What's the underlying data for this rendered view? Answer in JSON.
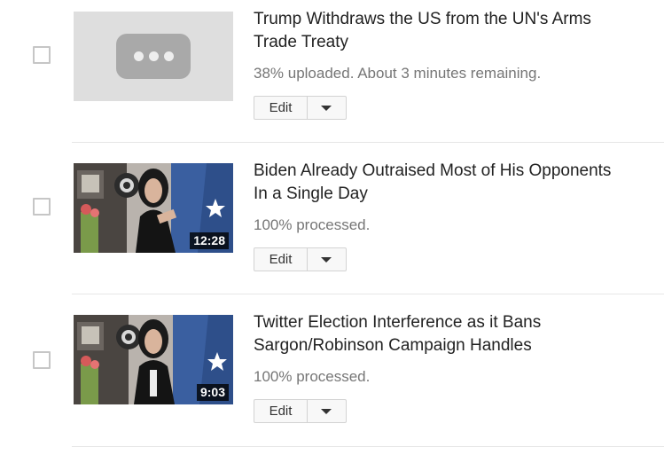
{
  "videos": [
    {
      "title": "Trump Withdraws the US from the UN's Arms Trade Treaty",
      "status": "38% uploaded. About 3 minutes remaining.",
      "duration": "",
      "thumbnail": "placeholder",
      "edit_label": "Edit"
    },
    {
      "title": "Biden Already Outraised Most of His Opponents In a Single Day",
      "status": "100% processed.",
      "duration": "12:28",
      "thumbnail": "person-with-flag",
      "edit_label": "Edit"
    },
    {
      "title": "Twitter Election Interference as it Bans Sargon/Robinson Campaign Handles",
      "status": "100% processed.",
      "duration": "9:03",
      "thumbnail": "person-with-flag",
      "edit_label": "Edit"
    }
  ],
  "icons": {
    "checkbox": "checkbox-icon",
    "dropdown": "caret-down-icon",
    "processing": "ellipsis-bubble-icon"
  },
  "colors": {
    "status_text": "#767676",
    "button_bg": "#f8f8f8",
    "divider": "#e6e6e6"
  }
}
